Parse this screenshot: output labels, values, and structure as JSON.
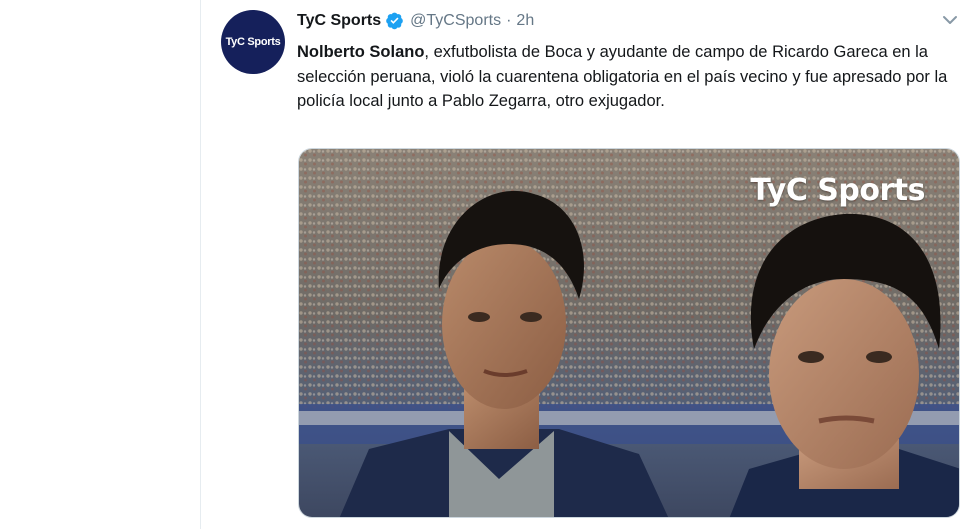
{
  "tweet": {
    "avatar_text": "TyC Sports",
    "display_name": "TyC Sports",
    "handle": "@TyCSports",
    "separator": "·",
    "timestamp": "2h",
    "text_bold": "Nolberto Solano",
    "text_rest": ", exfutbolista de Boca y ayudante de campo de Ricardo Gareca en la selección peruana, violó la cuarentena obligatoria en el país vecino y fue apresado por la policía local junto a Pablo Zegarra, otro exjugador.",
    "media_watermark": "TyC Sports"
  },
  "colors": {
    "avatar_bg": "#15205b",
    "verified": "#1da1f2",
    "secondary_text": "#657786"
  },
  "icons": [
    "verified-badge-icon",
    "chevron-down-icon"
  ]
}
